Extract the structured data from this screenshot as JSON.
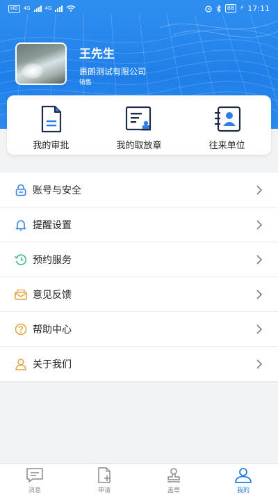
{
  "status_bar": {
    "hd_badge": "HD",
    "signal_1": "4G",
    "signal_2": "4G",
    "battery": "88",
    "time": "17:11"
  },
  "profile": {
    "name": "王先生",
    "company": "惠朗测试有限公司",
    "role": "销售"
  },
  "quick_actions": [
    {
      "label": "我的审批",
      "icon": "approval-doc-icon"
    },
    {
      "label": "我的取放章",
      "icon": "seal-doc-icon"
    },
    {
      "label": "往来单位",
      "icon": "contact-card-icon"
    }
  ],
  "menu": [
    {
      "label": "账号与安全",
      "icon": "lock-icon"
    },
    {
      "label": "提醒设置",
      "icon": "bell-icon"
    },
    {
      "label": "预约服务",
      "icon": "clock-history-icon"
    },
    {
      "label": "意见反馈",
      "icon": "mail-feedback-icon"
    },
    {
      "label": "帮助中心",
      "icon": "help-icon"
    },
    {
      "label": "关于我们",
      "icon": "person-icon"
    }
  ],
  "tabs": [
    {
      "label": "消息",
      "icon": "message-icon",
      "active": false
    },
    {
      "label": "申请",
      "icon": "apply-doc-icon",
      "active": false
    },
    {
      "label": "盖章",
      "icon": "stamp-icon",
      "active": false
    },
    {
      "label": "我的",
      "icon": "user-icon",
      "active": true
    }
  ],
  "colors": {
    "brand": "#1f7fe9",
    "icon_blue": "#2f7fe3",
    "icon_orange": "#e6a23c",
    "icon_green": "#39b18f"
  }
}
